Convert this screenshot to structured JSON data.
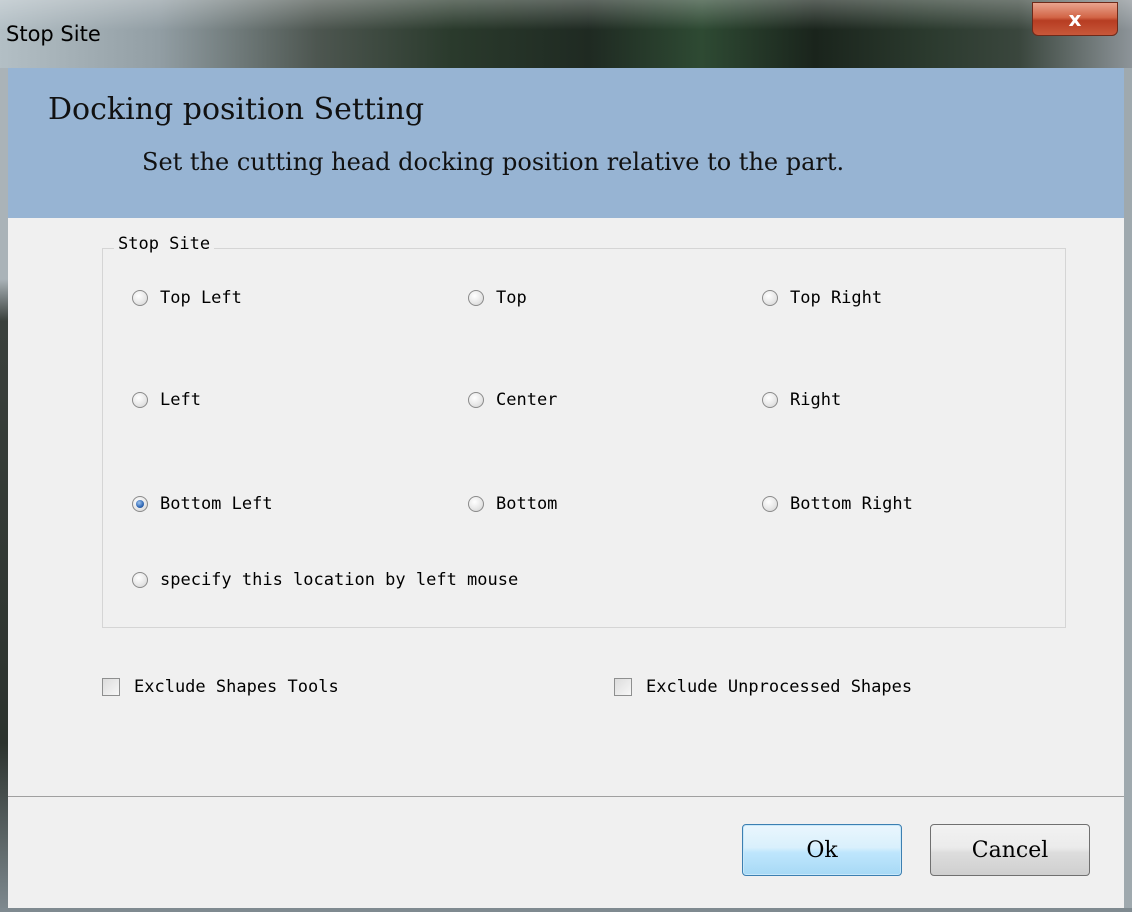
{
  "window": {
    "title": "Stop Site",
    "close_glyph": "x"
  },
  "banner": {
    "title": "Docking position Setting",
    "subtitle": "Set the cutting head docking position relative to the part."
  },
  "group": {
    "legend": "Stop Site",
    "options": [
      {
        "label": "Top Left",
        "checked": false
      },
      {
        "label": "Top",
        "checked": false
      },
      {
        "label": "Top Right",
        "checked": false
      },
      {
        "label": "Left",
        "checked": false
      },
      {
        "label": "Center",
        "checked": false
      },
      {
        "label": "Right",
        "checked": false
      },
      {
        "label": "Bottom Left",
        "checked": true
      },
      {
        "label": "Bottom",
        "checked": false
      },
      {
        "label": "Bottom Right",
        "checked": false
      },
      {
        "label": "specify this location by left mouse",
        "checked": false
      }
    ]
  },
  "checkboxes": [
    {
      "label": "Exclude Shapes Tools",
      "checked": false
    },
    {
      "label": "Exclude Unprocessed Shapes",
      "checked": false
    }
  ],
  "buttons": {
    "ok": "Ok",
    "cancel": "Cancel"
  }
}
